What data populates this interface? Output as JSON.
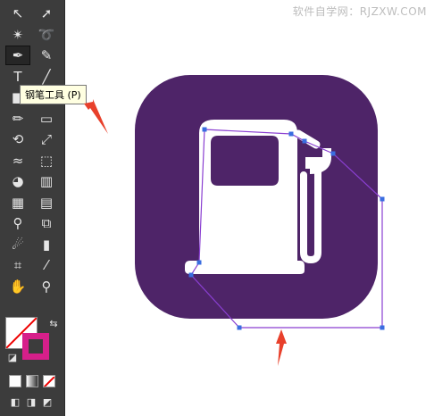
{
  "watermark": "软件自学网：RJZXW.COM",
  "tooltip": {
    "label": "钢笔工具 (P)"
  },
  "toolbar": {
    "tools": [
      {
        "name": "selection-tool",
        "glyph": "↖"
      },
      {
        "name": "direct-selection-tool",
        "glyph": "➚"
      },
      {
        "name": "magic-wand-tool",
        "glyph": "✴"
      },
      {
        "name": "lasso-tool",
        "glyph": "➰"
      },
      {
        "name": "pen-tool",
        "glyph": "✒"
      },
      {
        "name": "curvature-tool",
        "glyph": "✎"
      },
      {
        "name": "type-tool",
        "glyph": "T"
      },
      {
        "name": "line-tool",
        "glyph": "╱"
      },
      {
        "name": "rectangle-tool",
        "glyph": "■"
      },
      {
        "name": "paintbrush-tool",
        "glyph": "✐"
      },
      {
        "name": "pencil-tool",
        "glyph": "✏"
      },
      {
        "name": "eraser-tool",
        "glyph": "▭"
      },
      {
        "name": "rotate-tool",
        "glyph": "⟲"
      },
      {
        "name": "scale-tool",
        "glyph": "⤢"
      },
      {
        "name": "width-tool",
        "glyph": "≈"
      },
      {
        "name": "free-transform-tool",
        "glyph": "⬚"
      },
      {
        "name": "shape-builder-tool",
        "glyph": "◕"
      },
      {
        "name": "perspective-grid-tool",
        "glyph": "▥"
      },
      {
        "name": "mesh-tool",
        "glyph": "▦"
      },
      {
        "name": "gradient-tool",
        "glyph": "▤"
      },
      {
        "name": "eyedropper-tool",
        "glyph": "⚲"
      },
      {
        "name": "blend-tool",
        "glyph": "⧉"
      },
      {
        "name": "symbol-sprayer-tool",
        "glyph": "☄"
      },
      {
        "name": "column-graph-tool",
        "glyph": "▮"
      },
      {
        "name": "artboard-tool",
        "glyph": "⌗"
      },
      {
        "name": "slice-tool",
        "glyph": "⁄"
      },
      {
        "name": "hand-tool",
        "glyph": "✋"
      },
      {
        "name": "zoom-tool",
        "glyph": "⚲"
      }
    ]
  },
  "colors": {
    "toolbar_bg": "#3c3c3c",
    "icon_bg": "#4e2468",
    "icon_fg": "#ffffff",
    "path_stroke": "#8a3fd1",
    "anchor": "#3a6de0",
    "arrow": "#e8402b",
    "stroke_swatch": "#d61f8a"
  }
}
